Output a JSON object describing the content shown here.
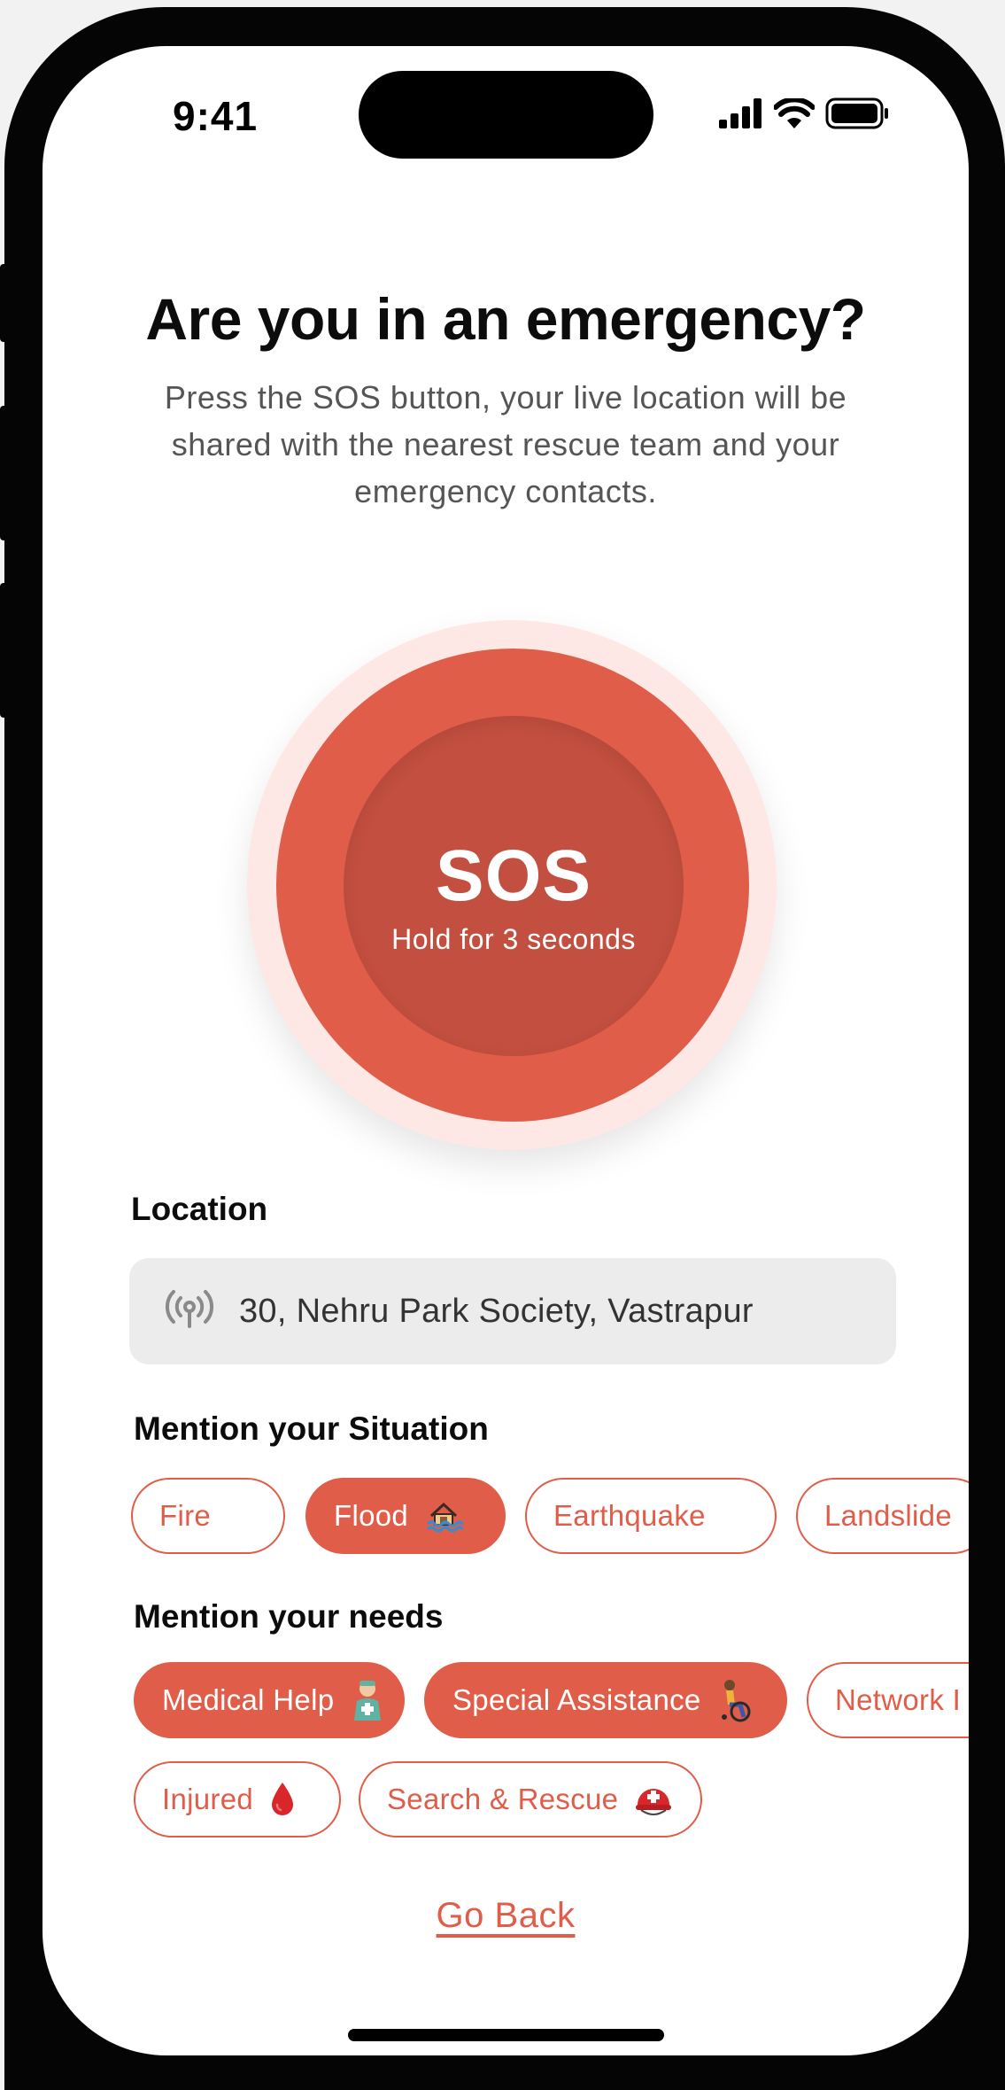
{
  "status": {
    "time": "9:41"
  },
  "header": {
    "title": "Are you in an emergency?",
    "subtitle": "Press the SOS button, your live location will be shared with the nearest rescue team and your emergency contacts."
  },
  "sos": {
    "label": "SOS",
    "hint": "Hold for 3 seconds",
    "color": "#e05d49"
  },
  "location": {
    "label": "Location",
    "address": "30, Nehru Park Society, Vastrapur",
    "icon": "broadcast-icon"
  },
  "situation": {
    "label": "Mention your Situation",
    "chips": [
      {
        "label": "Fire",
        "selected": false
      },
      {
        "label": "Flood",
        "selected": true,
        "icon": "house-flood-icon"
      },
      {
        "label": "Earthquake",
        "selected": false
      },
      {
        "label": "Landslide",
        "selected": false
      }
    ]
  },
  "needs": {
    "label": "Mention your needs",
    "chips": [
      {
        "label": "Medical Help",
        "selected": true,
        "icon": "health-worker-icon"
      },
      {
        "label": "Special Assistance",
        "selected": true,
        "icon": "wheelchair-person-icon"
      },
      {
        "label": "Network I",
        "selected": false
      },
      {
        "label": "Injured",
        "selected": false,
        "icon": "blood-drop-icon"
      },
      {
        "label": "Search & Rescue",
        "selected": false,
        "icon": "rescue-helmet-icon"
      }
    ]
  },
  "footer": {
    "go_back": "Go Back"
  },
  "colors": {
    "accent": "#e05d49",
    "accent_dark": "#c24f3f",
    "glow": "#fde8e5"
  }
}
